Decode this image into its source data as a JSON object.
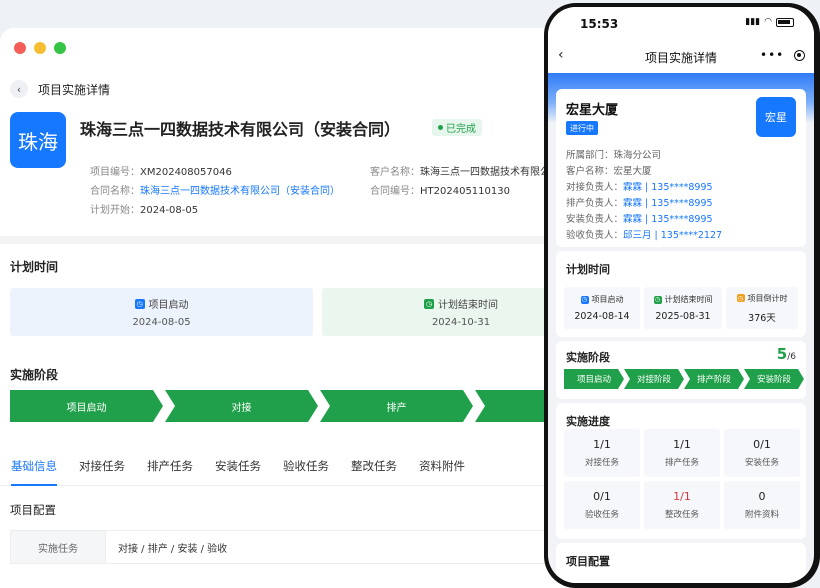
{
  "desktop": {
    "title": "项目实施详情",
    "logo_text": "珠海",
    "company_name": "珠海三点一四数据技术有限公司（安装合同）",
    "status_badge": "已完成",
    "info": {
      "project_no_label": "项目编号：",
      "project_no": "XM202408057046",
      "customer_label": "客户名称：",
      "customer": "珠海三点一四数据技术有限公司",
      "contract_name_label": "合同名称：",
      "contract_name": "珠海三点一四数据技术有限公司（安装合同）",
      "contract_no_label": "合同编号：",
      "contract_no": "HT202405110130",
      "plan_start_label": "计划开始：",
      "plan_start": "2024-08-05"
    },
    "plan": {
      "title": "计划时间",
      "items": [
        {
          "label": "项目启动",
          "date": "2024-08-05"
        },
        {
          "label": "计划结束时间",
          "date": "2024-10-31"
        }
      ]
    },
    "stages": {
      "title": "实施阶段",
      "items": [
        "项目启动",
        "对接",
        "排产",
        ""
      ]
    },
    "tabs": [
      "基础信息",
      "对接任务",
      "排产任务",
      "安装任务",
      "验收任务",
      "整改任务",
      "资料附件"
    ],
    "config": {
      "title": "项目配置",
      "row_label": "实施任务",
      "row_value": "对接 / 排产 / 安装 / 验收"
    },
    "colors": {
      "accent": "#1677ff",
      "success": "#20a04a"
    }
  },
  "phone": {
    "time": "15:53",
    "title": "项目实施详情",
    "project": {
      "name": "宏星大厦",
      "status": "进行中",
      "logo_text": "宏星",
      "lines": [
        {
          "label": "所属部门：",
          "value": "珠海分公司",
          "link": ""
        },
        {
          "label": "客户名称：",
          "value": "宏星大厦",
          "link": ""
        },
        {
          "label": "对接负责人：",
          "value": "",
          "link": "霖霖 | 135****8995"
        },
        {
          "label": "排产负责人：",
          "value": "",
          "link": "霖霖 | 135****8995"
        },
        {
          "label": "安装负责人：",
          "value": "",
          "link": "霖霖 | 135****8995"
        },
        {
          "label": "验收负责人：",
          "value": "",
          "link": "邱三月 | 135****2127"
        }
      ]
    },
    "plan": {
      "title": "计划时间",
      "items": [
        {
          "label": "项目启动",
          "value": "2024-08-14"
        },
        {
          "label": "计划结束时间",
          "value": "2025-08-31"
        },
        {
          "label": "项目倒计时",
          "value": "376天"
        }
      ]
    },
    "stages": {
      "title": "实施阶段",
      "done": "5",
      "total": "/6",
      "items": [
        "项目启动",
        "对接阶段",
        "排产阶段",
        "安装阶段"
      ]
    },
    "progress": {
      "title": "实施进度",
      "items": [
        {
          "num": "1/1",
          "label": "对接任务"
        },
        {
          "num": "1/1",
          "label": "排产任务"
        },
        {
          "num": "0/1",
          "label": "安装任务"
        },
        {
          "num": "0/1",
          "label": "验收任务"
        },
        {
          "num": "1/1",
          "label": "整改任务"
        },
        {
          "num": "0",
          "label": "附件资料"
        }
      ]
    },
    "config_title": "项目配置"
  }
}
